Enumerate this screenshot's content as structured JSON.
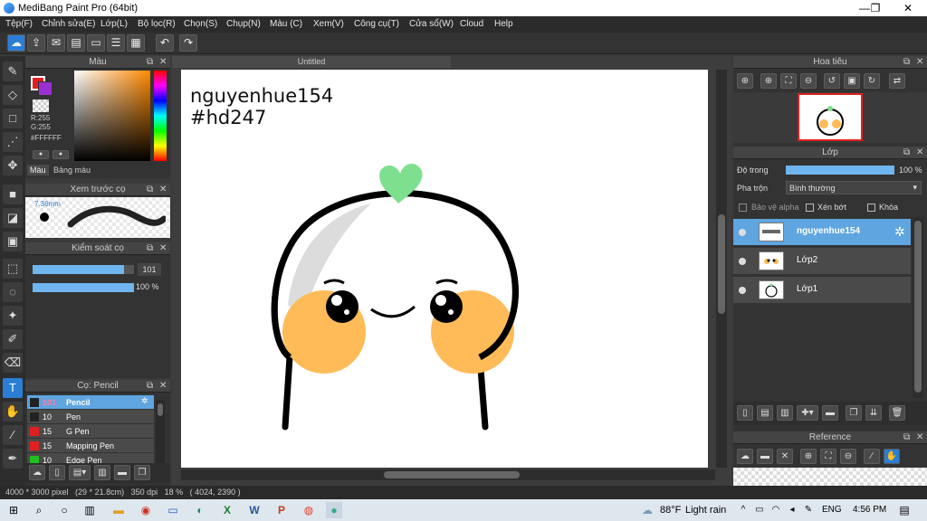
{
  "window": {
    "title": "MediBang Paint Pro (64bit)"
  },
  "menu": [
    "Tệp(F)",
    "Chỉnh sửa(E)",
    "Lớp(L)",
    "Bộ lọc(R)",
    "Chọn(S)",
    "Chụp(N)",
    "Màu (C)",
    "Xem(V)",
    "Công cụ(T)",
    "Cửa sổ(W)",
    "Cloud",
    "Help"
  ],
  "color_panel": {
    "title": "Màu",
    "r": "R:255",
    "g": "G:255",
    "hex": "#FFFFFF",
    "tabs": [
      "Màu",
      "Bảng màu"
    ]
  },
  "brush_preview": {
    "title": "Xem trước cọ",
    "size": "7.36mm"
  },
  "brush_control": {
    "title": "Kiểm soát cọ",
    "size_value": "101",
    "opacity_value": "100 %",
    "size_level": 0.9,
    "opacity_level": 1.0
  },
  "brush_list": {
    "title": "Cọ: Pencil",
    "items": [
      {
        "size": "101",
        "name": "Pencil",
        "color": "#222222"
      },
      {
        "size": "10",
        "name": "Pen",
        "color": "#222222"
      },
      {
        "size": "15",
        "name": "G Pen",
        "color": "#e02020"
      },
      {
        "size": "15",
        "name": "Mapping Pen",
        "color": "#e02020"
      },
      {
        "size": "10",
        "name": "Edge Pen",
        "color": "#20c020"
      }
    ]
  },
  "canvas": {
    "tab": "Untitled",
    "text_line1": "nguyenhue154",
    "text_line2": "#hd247"
  },
  "navigator": {
    "title": "Hoa tiêu"
  },
  "layer_panel": {
    "title": "Lớp",
    "opacity_label": "Độ trong",
    "opacity_value": "100 %",
    "opacity_level": 1.0,
    "blend_label": "Pha trộn",
    "blend_value": "Bình thường",
    "protect_alpha": "Bảo vệ alpha",
    "clipping": "Xén bớt",
    "lock": "Khóa",
    "layers": [
      {
        "name": "nguyenhue154"
      },
      {
        "name": "Lớp2"
      },
      {
        "name": "Lớp1"
      }
    ]
  },
  "reference": {
    "title": "Reference"
  },
  "status": {
    "info": "4000 * 3000 pixel   (29 * 21.8cm)   350 dpi   18 %   ( 4024, 2390 )"
  },
  "taskbar": {
    "weather_temp": "88°F",
    "weather_text": "Light rain",
    "lang": "ENG",
    "time": "4:56 PM"
  },
  "colors": {
    "accent": "#5fa5e0",
    "panel": "#333333",
    "header": "#444444"
  }
}
